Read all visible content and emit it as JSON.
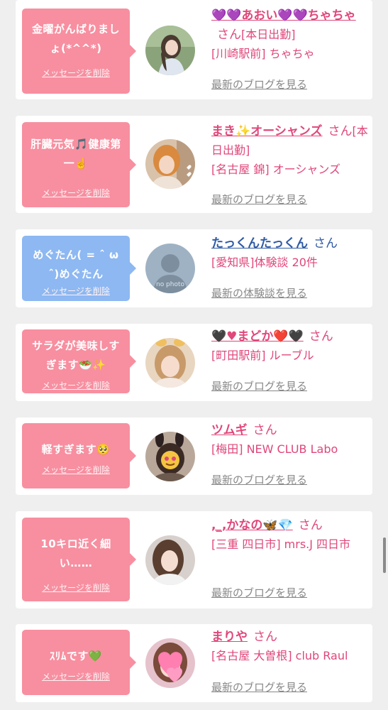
{
  "delete_label": "メッセージを削除",
  "san_label": "さん",
  "cards": [
    {
      "message": "金曜がんばりましょ(*^^*)",
      "name": "💜💜あおい💜💜ちゃちゃ",
      "details": [
        "[本日出勤]",
        "[川崎駅前] ちゃちゃ"
      ],
      "link": "最新のブログを見る",
      "bubble_color": "#f78fa0"
    },
    {
      "message": "肝臓元気🎵健康第一☝️",
      "name": "まき✨オーシャンズ",
      "details": [
        "[本日出勤]",
        "[名古屋 錦] オーシャンズ"
      ],
      "link": "最新のブログを見る",
      "bubble_color": "#f78fa0"
    },
    {
      "message": "めぐたん( = ˆ ω ˆ)めぐたん",
      "name": "たっくんたっくん",
      "details": [
        "[愛知県]体験談 20件"
      ],
      "link": "最新の体験談を見る",
      "bubble_color": "#8db8f2",
      "avatar_text": "no photo"
    },
    {
      "message": "サラダが美味しすぎます🥗✨",
      "name": "🖤♥まどか❤️🖤",
      "details": [
        "[町田駅前] ルーブル"
      ],
      "link": "最新のブログを見る",
      "bubble_color": "#f78fa0"
    },
    {
      "message": "軽すぎます🥺",
      "name": "ツムギ",
      "details": [
        "[梅田] NEW CLUB Labo"
      ],
      "link": "最新のブログを見る",
      "bubble_color": "#f78fa0"
    },
    {
      "message": "10キロ近く細い……",
      "name": ",_,かなの🦋💎",
      "details": [
        "[三重 四日市] mrs.J 四日市"
      ],
      "link": "最新のブログを見る",
      "bubble_color": "#f78fa0"
    },
    {
      "message": "ｽﾘﾑです💚",
      "name": "まりや",
      "details": [
        "[名古屋 大曽根] club Raul"
      ],
      "link": "最新のブログを見る",
      "bubble_color": "#f78fa0"
    }
  ]
}
